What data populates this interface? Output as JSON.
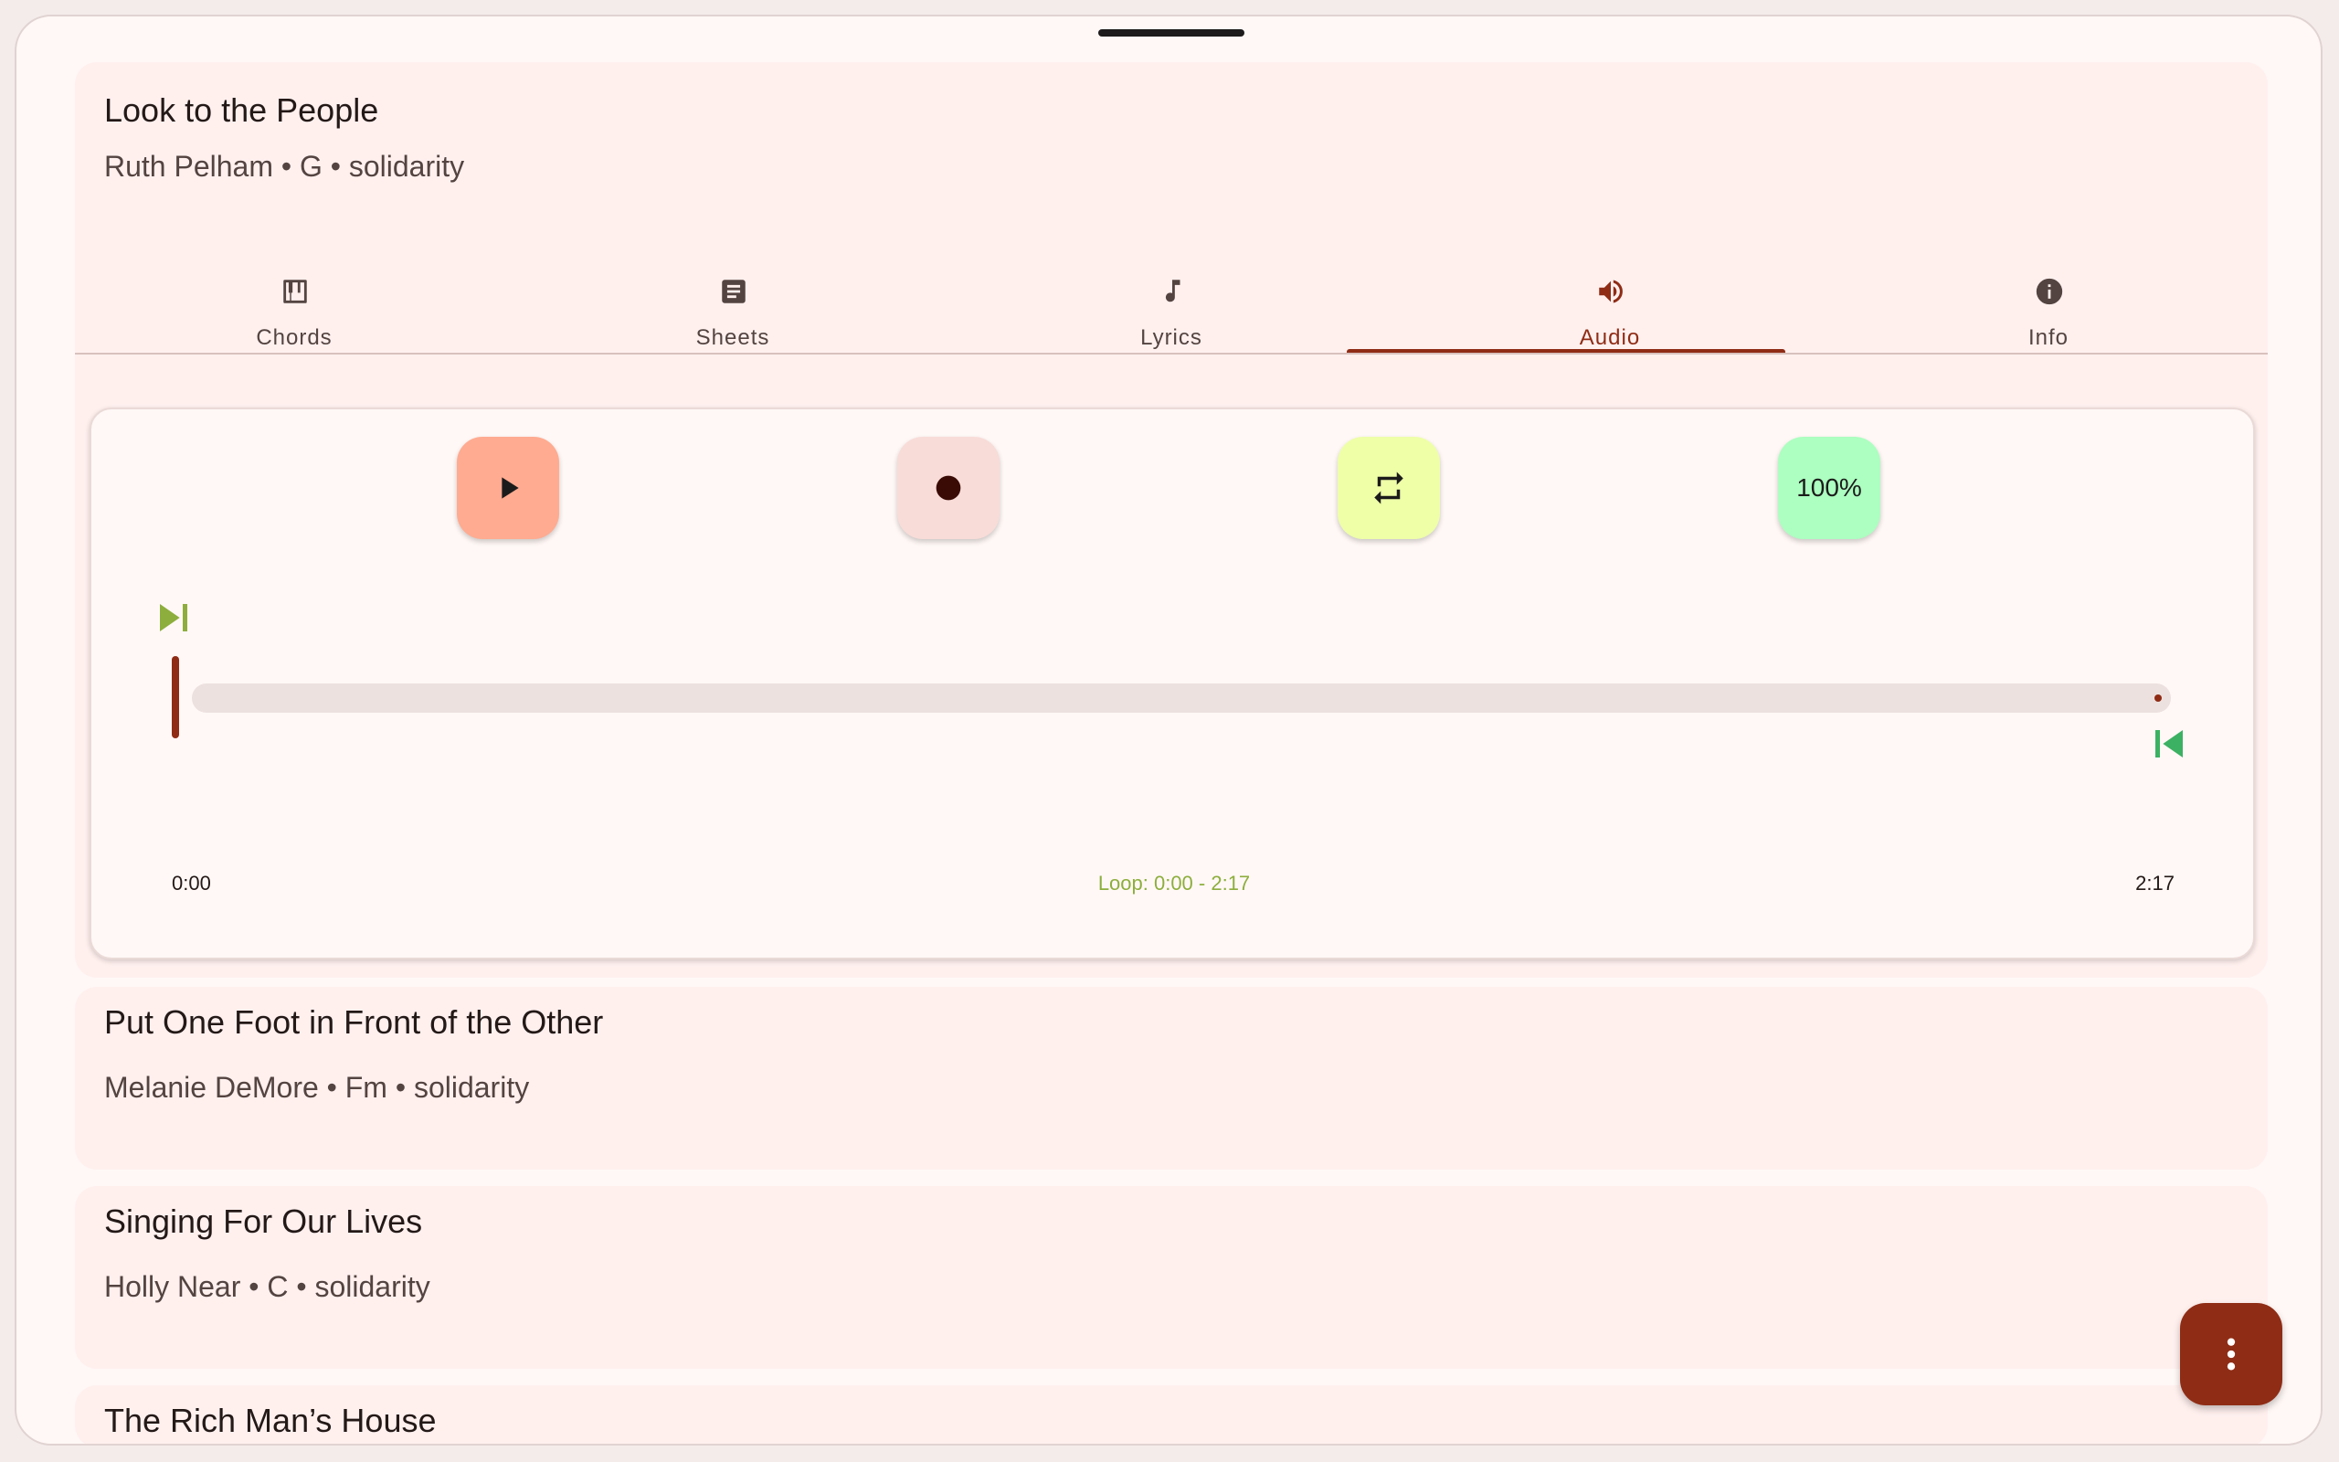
{
  "songs": [
    {
      "title": "Look to the People",
      "meta": "Ruth Pelham • G • solidarity"
    },
    {
      "title": "Put One Foot in Front of the Other",
      "meta": "Melanie DeMore • Fm • solidarity"
    },
    {
      "title": "Singing For Our Lives",
      "meta": "Holly Near • C • solidarity"
    },
    {
      "title": "The Rich Man’s House",
      "meta": ""
    }
  ],
  "tabs": [
    {
      "label": "Chords",
      "icon": "piano-icon"
    },
    {
      "label": "Sheets",
      "icon": "document-icon"
    },
    {
      "label": "Lyrics",
      "icon": "music-note-icon"
    },
    {
      "label": "Audio",
      "icon": "volume-icon",
      "active": true
    },
    {
      "label": "Info",
      "icon": "info-icon"
    }
  ],
  "player": {
    "speed_label": "100%",
    "time_start": "0:00",
    "time_end": "2:17",
    "loop_label": "Loop: 0:00 - 2:17",
    "position_fraction": 0
  },
  "colors": {
    "accent": "#8f2c15",
    "play_button": "#ffab91",
    "record_button": "#f8dcd8",
    "loop_button": "#eeffa8",
    "speed_button": "#acffc0",
    "loop_start_marker": "#8dae3d",
    "loop_end_marker": "#3cb163"
  }
}
